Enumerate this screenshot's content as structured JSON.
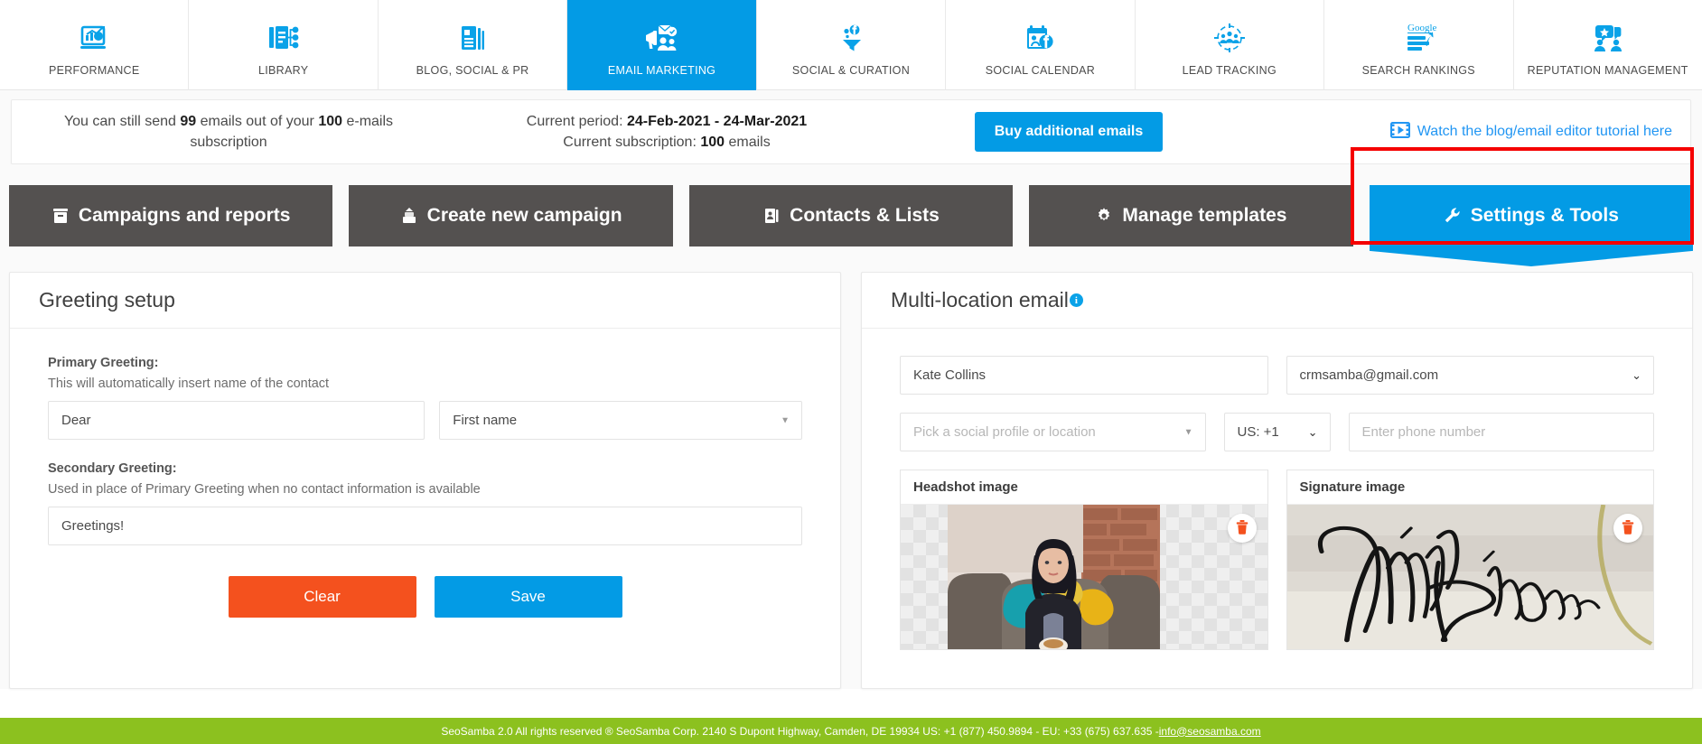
{
  "nav": {
    "items": [
      {
        "label": "PERFORMANCE",
        "icon": "performance-chart-icon",
        "active": false
      },
      {
        "label": "LIBRARY",
        "icon": "library-documents-icon",
        "active": false
      },
      {
        "label": "BLOG, SOCIAL & PR",
        "icon": "blog-article-icon",
        "active": false
      },
      {
        "label": "EMAIL MARKETING",
        "icon": "email-megaphone-icon",
        "active": true
      },
      {
        "label": "SOCIAL & CURATION",
        "icon": "social-funnel-icon",
        "active": false
      },
      {
        "label": "SOCIAL CALENDAR",
        "icon": "social-calendar-icon",
        "active": false
      },
      {
        "label": "LEAD TRACKING",
        "icon": "lead-target-icon",
        "active": false
      },
      {
        "label": "SEARCH RANKINGS",
        "icon": "google-ranking-icon",
        "active": false
      },
      {
        "label": "REPUTATION MANAGEMENT",
        "icon": "reputation-people-icon",
        "active": false
      }
    ]
  },
  "info_bar": {
    "quota_prefix": "You can still send ",
    "quota_remaining": "99",
    "quota_middle": " emails out of your ",
    "quota_total": "100",
    "quota_suffix": " e-mails subscription",
    "period_label": "Current period: ",
    "period_value": "24-Feb-2021 - 24-Mar-2021",
    "subscription_label": "Current subscription: ",
    "subscription_value": "100",
    "subscription_suffix": " emails",
    "buy_button": "Buy additional emails",
    "tutorial_link": "Watch the blog/email editor tutorial here",
    "tutorial_icon": "video-play-icon"
  },
  "tabs": [
    {
      "label": "Campaigns and reports",
      "icon": "archive-box-icon",
      "selected": false
    },
    {
      "label": "Create new campaign",
      "icon": "inbox-upload-icon",
      "selected": false
    },
    {
      "label": "Contacts & Lists",
      "icon": "address-book-icon",
      "selected": false
    },
    {
      "label": "Manage templates",
      "icon": "gear-icon",
      "selected": false
    },
    {
      "label": "Settings & Tools",
      "icon": "wrench-icon",
      "selected": true
    }
  ],
  "greeting_panel": {
    "title": "Greeting setup",
    "primary_label": "Primary Greeting:",
    "primary_hint": "This will automatically insert name of the contact",
    "primary_text_value": "Dear",
    "primary_token_value": "First name",
    "secondary_label": "Secondary Greeting:",
    "secondary_hint": "Used in place of Primary Greeting when no contact information is available",
    "secondary_value": "Greetings!",
    "clear_button": "Clear",
    "save_button": "Save",
    "clear_color": "#f4511e",
    "save_color": "#039be5"
  },
  "multilocation_panel": {
    "title": "Multi-location email",
    "info_icon": "info-icon",
    "name_value": "Kate Collins",
    "email_value": "crmsamba@gmail.com",
    "profile_placeholder": "Pick a social profile or location",
    "country_code_value": "US: +1",
    "phone_placeholder": "Enter phone number",
    "headshot_label": "Headshot image",
    "signature_label": "Signature image",
    "delete_icon": "trash-icon",
    "delete_color": "#f4511e"
  },
  "footer": {
    "text": "SeoSamba 2.0  All rights reserved ® SeoSamba Corp. 2140 S Dupont Highway, Camden, DE 19934 US: +1 (877) 450.9894 - EU: +33 (675) 637.635 - ",
    "email_link": "info@seosamba.com",
    "background": "#8cc11f"
  },
  "highlight": {
    "color": "#f50000"
  }
}
